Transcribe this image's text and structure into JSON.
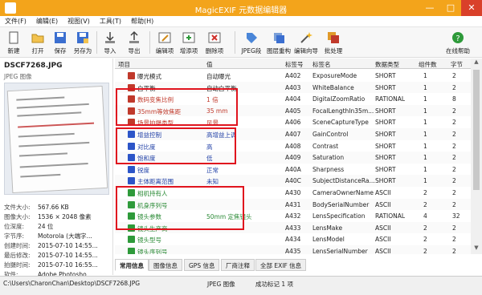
{
  "window": {
    "title": "MagicEXIF 元数据编辑器",
    "controls": [
      "—",
      "□",
      "✕"
    ]
  },
  "menu": [
    "文件(F)",
    "编辑(E)",
    "视图(V)",
    "工具(T)",
    "帮助(H)"
  ],
  "toolbar": {
    "items": [
      "新建",
      "打开",
      "保存",
      "另存为",
      "导入",
      "导出",
      "编辑项",
      "增添项",
      "删除项",
      "JPEG段",
      "图层重构",
      "编辑向导",
      "批处理",
      "在线帮助"
    ]
  },
  "file": {
    "name": "DSCF7268.JPG",
    "type": "JPEG 图像",
    "props": [
      {
        "k": "文件大小:",
        "v": "567.66 KB"
      },
      {
        "k": "图像大小:",
        "v": "1536 × 2048 像素"
      },
      {
        "k": "位深度:",
        "v": "24 位"
      },
      {
        "k": "字节序:",
        "v": "Motorola (大端字..."
      },
      {
        "k": "创建时间:",
        "v": "2015-07-10 14:55..."
      },
      {
        "k": "最后修改:",
        "v": "2015-07-10 14:55..."
      },
      {
        "k": "拍摄时间:",
        "v": "2015-07-10 16:55..."
      },
      {
        "k": "软件:",
        "v": "Adobe Photosho..."
      }
    ]
  },
  "table": {
    "headers": [
      "项目",
      "值",
      "标签号",
      "标签名",
      "数据类型",
      "组件数",
      "字节"
    ],
    "rows": [
      {
        "item": "曝光模式",
        "value": "自动曝光",
        "tag": "A402",
        "name": "ExposureMode",
        "type": "SHORT",
        "count": "1",
        "bytes": "2",
        "icon": "#c0392b",
        "color": "#222"
      },
      {
        "item": "白平衡",
        "value": "自动白平衡",
        "tag": "A403",
        "name": "WhiteBalance",
        "type": "SHORT",
        "count": "1",
        "bytes": "2",
        "icon": "#c0392b",
        "color": "#222"
      },
      {
        "item": "数码变焦比例",
        "value": "1 倍",
        "tag": "A404",
        "name": "DigitalZoomRatio",
        "type": "RATIONAL",
        "count": "1",
        "bytes": "8",
        "icon": "#c0392b",
        "color": "#c0392b"
      },
      {
        "item": "35mm等效焦距",
        "value": "35 mm",
        "tag": "A405",
        "name": "FocalLengthIn35m...",
        "type": "SHORT",
        "count": "1",
        "bytes": "2",
        "icon": "#c0392b",
        "color": "#c0392b"
      },
      {
        "item": "场景拍摄类型",
        "value": "风景",
        "tag": "A406",
        "name": "SceneCaptureType",
        "type": "SHORT",
        "count": "1",
        "bytes": "2",
        "icon": "#c0392b",
        "color": "#c0392b"
      },
      {
        "item": "增益控制",
        "value": "高增益上调",
        "tag": "A407",
        "name": "GainControl",
        "type": "SHORT",
        "count": "1",
        "bytes": "2",
        "icon": "#2c55c8",
        "color": "#1f3fa6"
      },
      {
        "item": "对比度",
        "value": "高",
        "tag": "A408",
        "name": "Contrast",
        "type": "SHORT",
        "count": "1",
        "bytes": "2",
        "icon": "#2c55c8",
        "color": "#1f3fa6"
      },
      {
        "item": "饱和度",
        "value": "低",
        "tag": "A409",
        "name": "Saturation",
        "type": "SHORT",
        "count": "1",
        "bytes": "2",
        "icon": "#2c55c8",
        "color": "#1f3fa6"
      },
      {
        "item": "锐度",
        "value": "正常",
        "tag": "A40A",
        "name": "Sharpness",
        "type": "SHORT",
        "count": "1",
        "bytes": "2",
        "icon": "#2c55c8",
        "color": "#1f3fa6"
      },
      {
        "item": "主体距离范围",
        "value": "未知",
        "tag": "A40C",
        "name": "SubjectDistanceRa...",
        "type": "SHORT",
        "count": "1",
        "bytes": "2",
        "icon": "#2c55c8",
        "color": "#1f3fa6"
      },
      {
        "item": "相机持有人",
        "value": "",
        "tag": "A430",
        "name": "CameraOwnerName",
        "type": "ASCII",
        "count": "2",
        "bytes": "2",
        "icon": "#2e9a3a",
        "color": "#2a8a35"
      },
      {
        "item": "机身序列号",
        "value": "",
        "tag": "A431",
        "name": "BodySerialNumber",
        "type": "ASCII",
        "count": "2",
        "bytes": "2",
        "icon": "#2e9a3a",
        "color": "#2a8a35"
      },
      {
        "item": "镜头参数",
        "value": "50mm 定焦镜头",
        "tag": "A432",
        "name": "LensSpecification",
        "type": "RATIONAL",
        "count": "4",
        "bytes": "32",
        "icon": "#2e9a3a",
        "color": "#2a8a35"
      },
      {
        "item": "镜头生产商",
        "value": "",
        "tag": "A433",
        "name": "LensMake",
        "type": "ASCII",
        "count": "2",
        "bytes": "2",
        "icon": "#2e9a3a",
        "color": "#2a8a35"
      },
      {
        "item": "镜头型号",
        "value": "",
        "tag": "A434",
        "name": "LensModel",
        "type": "ASCII",
        "count": "2",
        "bytes": "2",
        "icon": "#2e9a3a",
        "color": "#2a8a35"
      },
      {
        "item": "镜头序列号",
        "value": "",
        "tag": "A435",
        "name": "LensSerialNumber",
        "type": "ASCII",
        "count": "2",
        "bytes": "2",
        "icon": "#2e9a3a",
        "color": "#2a8a35"
      }
    ]
  },
  "tabs": [
    "常用信息",
    "图像信息",
    "GPS 信息",
    "厂商注释",
    "全部 EXIF 信息"
  ],
  "status": {
    "path": "C:\\Users\\CharonChan\\Desktop\\DSCF7268.JPG",
    "type": "JPEG 图像",
    "msg": "成功标记 1 项"
  }
}
